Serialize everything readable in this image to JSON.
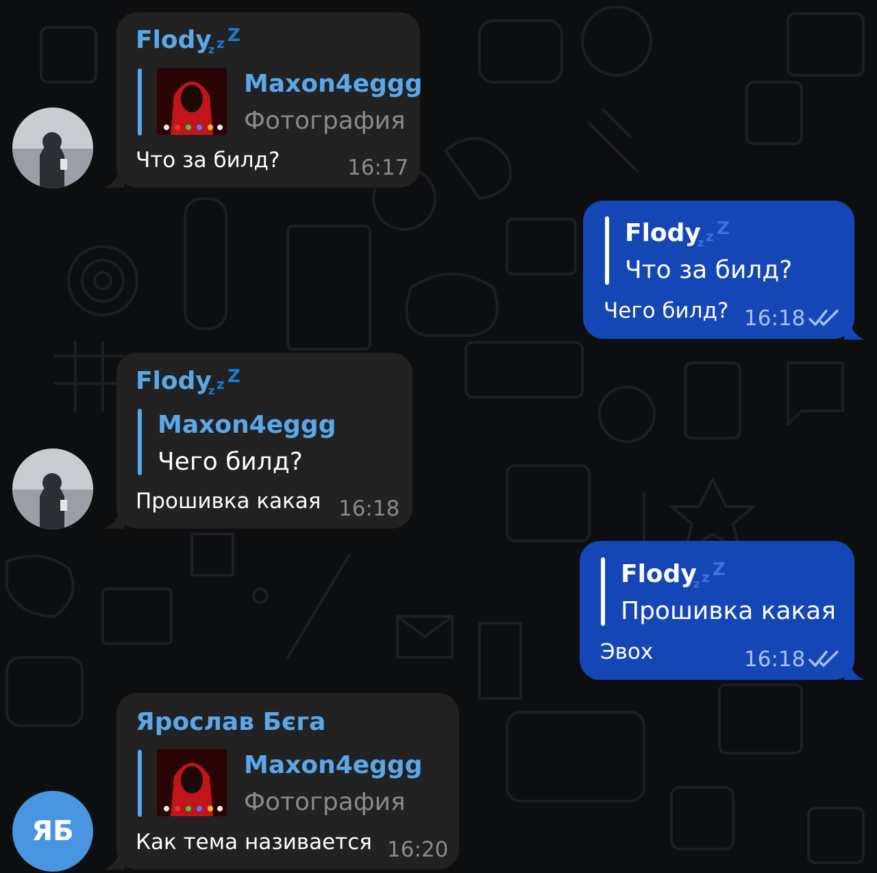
{
  "colors": {
    "background": "#0d0e10",
    "incoming_bubble": "#212121",
    "outgoing_bubble": "#1546b5",
    "accent_name": "#5aa7ea",
    "time_gray": "#8a8a8a",
    "avatar_ya_bg": "#4a95e0"
  },
  "messages": [
    {
      "direction": "incoming",
      "sender": "Flody",
      "sender_badge": "sleeping-zzz-icon",
      "reply": {
        "author": "Maxon4eggg",
        "preview": "Фотография",
        "has_thumbnail": true
      },
      "text": "Что за билд?",
      "time": "16:17",
      "avatar": "user-photo-avatar"
    },
    {
      "direction": "outgoing",
      "reply": {
        "author": "Flody",
        "author_badge": "sleeping-zzz-icon",
        "preview": "Что за билд?"
      },
      "text": "Чего билд?",
      "time": "16:18",
      "status": "read-double-check-icon"
    },
    {
      "direction": "incoming",
      "sender": "Flody",
      "sender_badge": "sleeping-zzz-icon",
      "reply": {
        "author": "Maxon4eggg",
        "preview": "Чего билд?"
      },
      "text": "Прошивка какая",
      "time": "16:18",
      "avatar": "user-photo-avatar"
    },
    {
      "direction": "outgoing",
      "reply": {
        "author": "Flody",
        "author_badge": "sleeping-zzz-icon",
        "preview": "Прошивка какая"
      },
      "text": "Эвох",
      "time": "16:18",
      "status": "read-double-check-icon"
    },
    {
      "direction": "incoming",
      "sender": "Ярослав Бєга",
      "reply": {
        "author": "Maxon4eggg",
        "preview": "Фотография",
        "has_thumbnail": true
      },
      "text": "Как тема називается",
      "time": "16:20",
      "avatar_initials": "ЯБ"
    }
  ]
}
